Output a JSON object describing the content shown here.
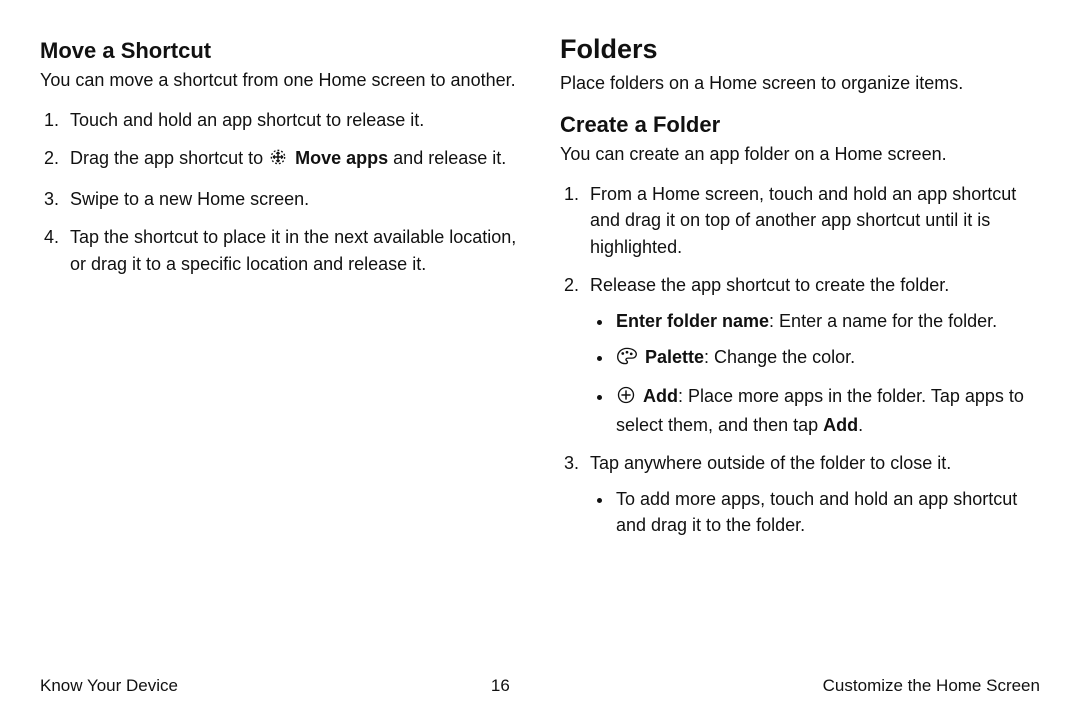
{
  "left": {
    "heading": "Move a Shortcut",
    "intro": "You can move a shortcut from one Home screen to another.",
    "steps": {
      "s1": "Touch and hold an app shortcut to release it.",
      "s2_pre": "Drag the app shortcut to ",
      "s2_bold": "Move apps",
      "s2_post": " and release it.",
      "s3": "Swipe to a new Home screen.",
      "s4": "Tap the shortcut to place it in the next available location, or drag it to a specific location and release it."
    }
  },
  "right": {
    "title": "Folders",
    "intro1": "Place folders on a Home screen to organize items.",
    "heading": "Create a Folder",
    "intro2": "You can create an app folder on a Home screen.",
    "steps": {
      "s1": "From a Home screen, touch and hold an app shortcut and drag it on top of another app shortcut until it is highlighted.",
      "s2": "Release the app shortcut to create the folder.",
      "b1_bold": "Enter folder name",
      "b1_rest": ": Enter a name for the folder.",
      "b2_bold": "Palette",
      "b2_rest": ": Change the color.",
      "b3_bold": "Add",
      "b3_mid": ": Place more apps in the folder. Tap apps to select them, and then tap ",
      "b3_bold2": "Add",
      "b3_end": ".",
      "s3": "Tap anywhere outside of the folder to close it.",
      "b4": "To add more apps, touch and hold an app shortcut and drag it to the folder."
    }
  },
  "footer": {
    "left": "Know Your Device",
    "page": "16",
    "right": "Customize the Home Screen"
  }
}
